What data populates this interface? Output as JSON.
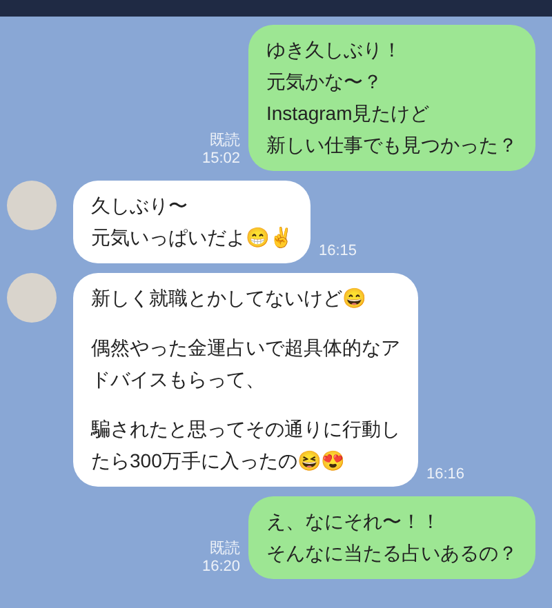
{
  "messages": [
    {
      "kind": "sent",
      "paragraphs": [
        [
          "ゆき久しぶり！",
          "元気かな〜？",
          "Instagram見たけど",
          "新しい仕事でも見つかった？"
        ]
      ],
      "read": "既読",
      "time": "15:02"
    },
    {
      "kind": "received",
      "paragraphs": [
        [
          "久しぶり〜",
          "元気いっぱいだよ😁✌"
        ]
      ],
      "time": "16:15"
    },
    {
      "kind": "received",
      "paragraphs": [
        [
          "新しく就職とかしてないけど😄"
        ],
        [
          "偶然やった金運占いで超具体的なア",
          "ドバイスもらって、"
        ],
        [
          "騙されたと思ってその通りに行動し",
          "たら300万手に入ったの😆😍"
        ]
      ],
      "time": "16:16"
    },
    {
      "kind": "sent",
      "paragraphs": [
        [
          "え、なにそれ〜！！",
          "そんなに当たる占いあるの？"
        ]
      ],
      "read": "既読",
      "time": "16:20"
    }
  ]
}
